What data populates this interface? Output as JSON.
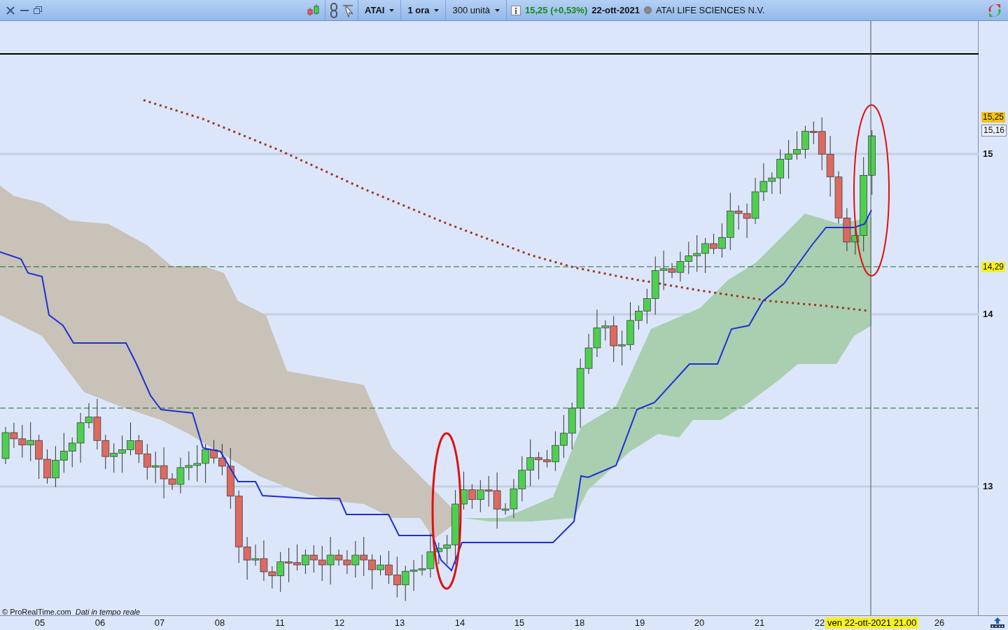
{
  "toolbar": {
    "symbol": "ATAI",
    "timeframe": "1 ora",
    "units": "300 unità",
    "price_change": "15,25 (+0,53%)",
    "date": "22-ott-2021",
    "instrument": "ATAI LIFE SCIENCES N.V."
  },
  "price_axis": {
    "ticks": [
      "15",
      "14",
      "13"
    ],
    "tags": [
      {
        "text": "15,25",
        "kind": "last"
      },
      {
        "text": "15,16",
        "kind": "reference"
      },
      {
        "text": "14,29",
        "kind": "level"
      }
    ]
  },
  "time_axis": {
    "labels": [
      "05",
      "06",
      "07",
      "08",
      "11",
      "12",
      "13",
      "14",
      "15",
      "18",
      "19",
      "20",
      "21",
      "22",
      "26"
    ],
    "cursor_label": "ven 22-ott-2021 21.00"
  },
  "footer": {
    "copyright": "© ProRealTime.com",
    "realtime_note": "Dati in tempo reale"
  }
}
